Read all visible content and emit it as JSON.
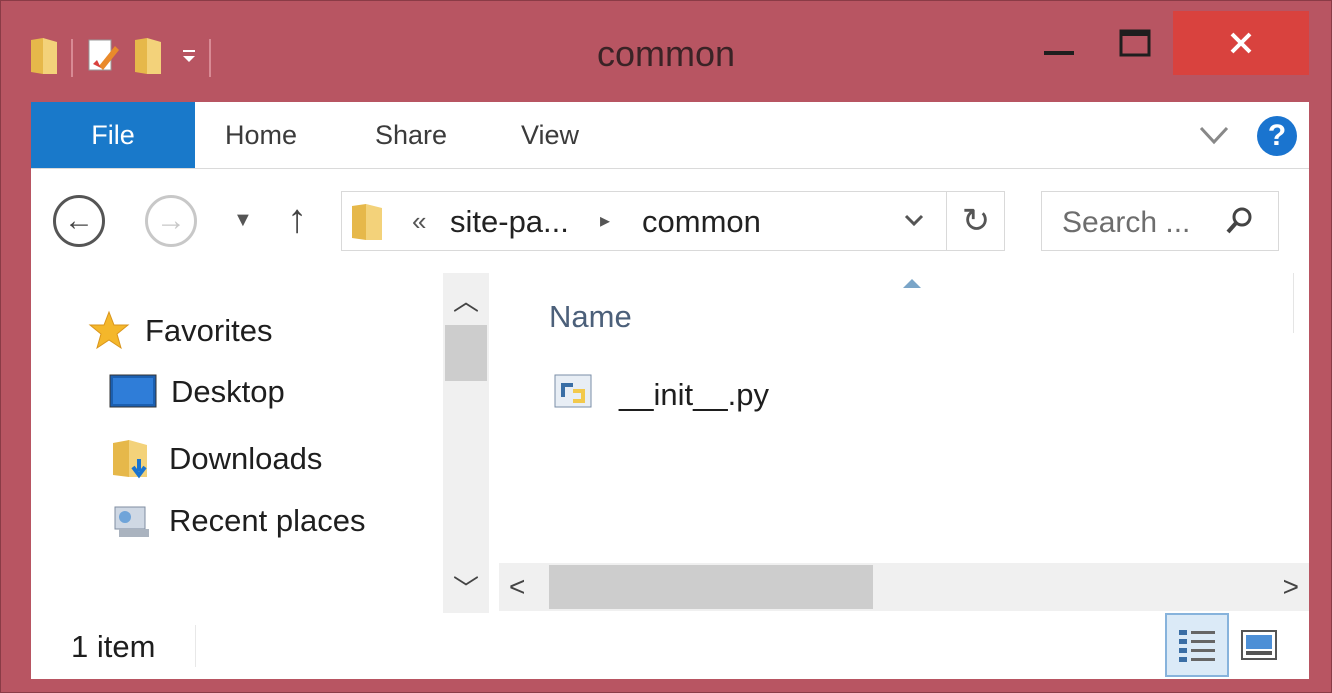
{
  "window": {
    "title": "common"
  },
  "ribbon": {
    "tabs": [
      {
        "label": "File"
      },
      {
        "label": "Home"
      },
      {
        "label": "Share"
      },
      {
        "label": "View"
      }
    ],
    "help_label": "?"
  },
  "address": {
    "overflow_glyph": "«",
    "crumbs": [
      "site-pa...",
      "common"
    ],
    "separator_glyph": "▸"
  },
  "search": {
    "placeholder": "Search ..."
  },
  "nav": {
    "items": [
      {
        "label": "Favorites",
        "icon": "star-icon"
      },
      {
        "label": "Desktop",
        "icon": "desktop-icon"
      },
      {
        "label": "Downloads",
        "icon": "downloads-folder-icon"
      },
      {
        "label": "Recent places",
        "icon": "recent-places-icon"
      }
    ]
  },
  "file_list": {
    "column_name": "Name",
    "files": [
      {
        "name": "__init__.py",
        "icon": "python-file-icon"
      }
    ]
  },
  "status": {
    "item_count": "1 item"
  },
  "colors": {
    "frame": "#b85562",
    "file_tab": "#1979ca",
    "close_button": "#d9423e",
    "help": "#1a74cf"
  }
}
